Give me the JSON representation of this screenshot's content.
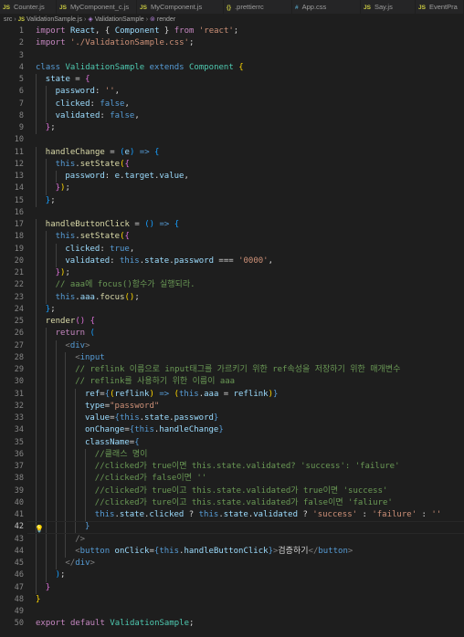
{
  "tabs": [
    {
      "icon": "JS",
      "label": "Counter.js",
      "active": false
    },
    {
      "icon": "JS",
      "label": "MyComponent_c.js",
      "active": false
    },
    {
      "icon": "JS",
      "label": "MyComponent.js",
      "active": false
    },
    {
      "icon": "{}",
      "label": ".prettierrc",
      "active": false
    },
    {
      "icon": "#",
      "label": "App.css",
      "active": false
    },
    {
      "icon": "JS",
      "label": "Say.js",
      "active": false
    },
    {
      "icon": "JS",
      "label": "EventPra",
      "active": false
    }
  ],
  "breadcrumb": {
    "folder": "src",
    "file": "ValidationSample.js",
    "class_name": "ValidationSample",
    "method": "render"
  },
  "colors": {
    "keyword": "#c586c0",
    "storage": "#569cd6",
    "class": "#4ec9b0",
    "function": "#dcdcaa",
    "string": "#ce9178",
    "variable": "#9cdcfe",
    "constant": "#4fc1ff",
    "comment": "#6a9955"
  },
  "editor": {
    "current_line": 42,
    "lightbulb_line": 42,
    "lines": [
      {
        "n": "1",
        "indent": 0,
        "tokens": [
          [
            "k",
            "import "
          ],
          [
            "v",
            "React"
          ],
          [
            "",
            "{ "
          ],
          [
            "b",
            ""
          ]
        ]
      },
      {
        "n": "2",
        "indent": 0,
        "tokens": []
      },
      {
        "n": "3",
        "indent": 0,
        "tokens": []
      },
      {
        "n": "4",
        "indent": 0,
        "tokens": []
      },
      {
        "n": "5",
        "indent": 0,
        "tokens": []
      },
      {
        "n": "6",
        "indent": 0,
        "tokens": []
      },
      {
        "n": "7",
        "indent": 0,
        "tokens": []
      },
      {
        "n": "8",
        "indent": 0,
        "tokens": []
      },
      {
        "n": "9",
        "indent": 0,
        "tokens": []
      },
      {
        "n": "10",
        "indent": 0,
        "tokens": []
      }
    ]
  }
}
